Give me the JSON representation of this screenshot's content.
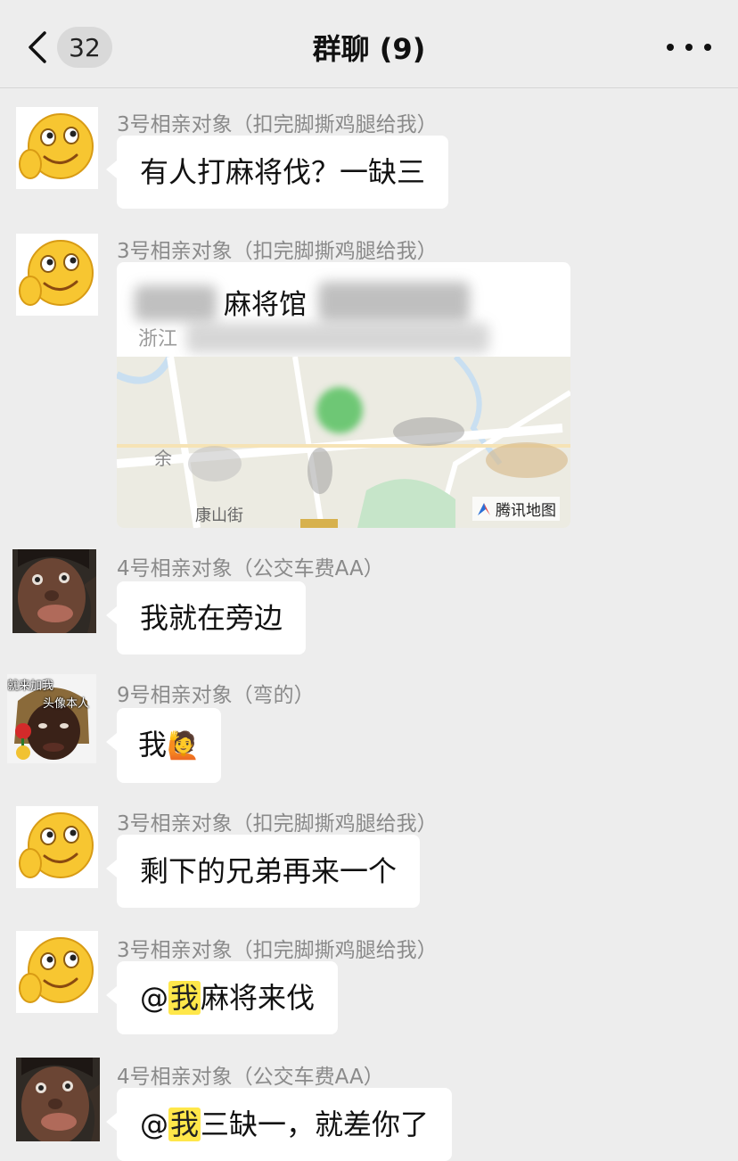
{
  "header": {
    "back_count": "32",
    "title": "群聊 (9)"
  },
  "colors": {
    "background": "#ededed",
    "bubble": "#ffffff",
    "nickname": "#8a8a8a",
    "mention_highlight": "#ffe74a"
  },
  "messages": [
    {
      "sender": "3号相亲对象（扣完脚撕鸡腿给我）",
      "avatar": "smiling-emoji-avatar",
      "text": "有人打麻将伐？一缺三"
    },
    {
      "sender": "3号相亲对象（扣完脚撕鸡腿给我）",
      "avatar": "smiling-emoji-avatar",
      "type": "location",
      "location": {
        "name": "麻将馆",
        "address": "浙江",
        "map_brand": "腾讯地图",
        "map_labels": [
          "余",
          "康山街"
        ]
      }
    },
    {
      "sender": "4号相亲对象（公交车费AA）",
      "avatar": "face-photo-avatar",
      "text": "我就在旁边"
    },
    {
      "sender": "9号相亲对象（弯的）",
      "avatar": "face-rose-avatar",
      "avatar_captions": [
        "就来加我",
        "头像本人"
      ],
      "text": "我",
      "emoji": "🙋"
    },
    {
      "sender": "3号相亲对象（扣完脚撕鸡腿给我）",
      "avatar": "smiling-emoji-avatar",
      "text": "剩下的兄弟再来一个"
    },
    {
      "sender": "3号相亲对象（扣完脚撕鸡腿给我）",
      "avatar": "smiling-emoji-avatar",
      "mention": "我",
      "text": "麻将来伐"
    },
    {
      "sender": "4号相亲对象（公交车费AA）",
      "avatar": "face-photo-avatar",
      "mention": "我",
      "text": "三缺一，就差你了"
    }
  ]
}
